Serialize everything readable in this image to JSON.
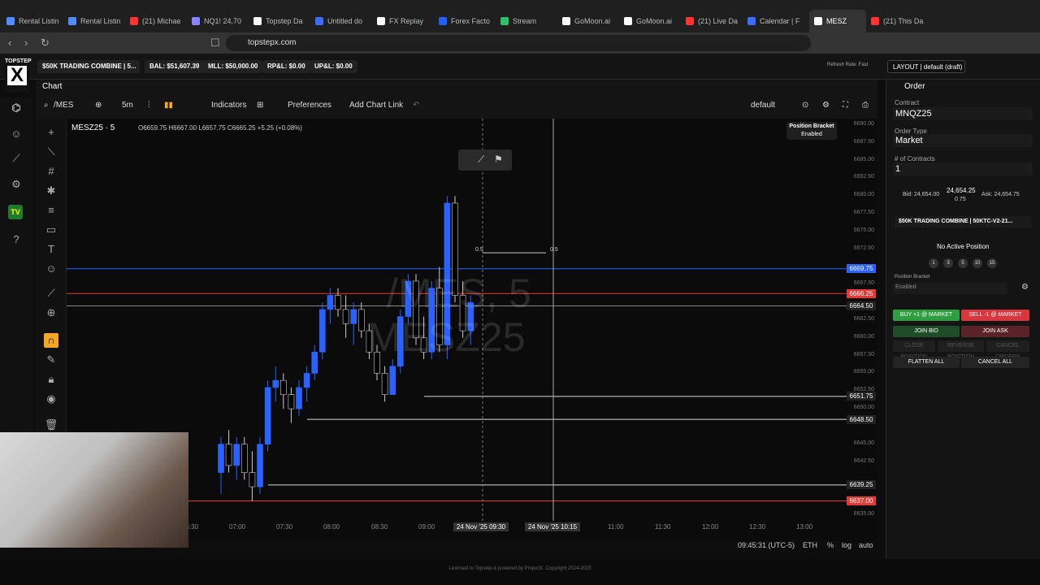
{
  "browser": {
    "tabs": [
      {
        "label": "Rental Listin",
        "color": "#4f8cff"
      },
      {
        "label": "Rental Listin",
        "color": "#4f8cff"
      },
      {
        "label": "(21) Michae",
        "color": "#ff3333"
      },
      {
        "label": "NQ1! 24,70",
        "color": "#8884ff"
      },
      {
        "label": "Topstep Da",
        "color": "#ffffff"
      },
      {
        "label": "Untitled do",
        "color": "#3d6bff"
      },
      {
        "label": "FX Replay",
        "color": "#ffffff"
      },
      {
        "label": "Forex Facto",
        "color": "#1f5fff"
      },
      {
        "label": "Stream",
        "color": "#29c36a"
      },
      {
        "label": "GoMoon.ai",
        "color": "#ffffff"
      },
      {
        "label": "GoMoon.ai",
        "color": "#ffffff"
      },
      {
        "label": "(21) Live Da",
        "color": "#ff3333"
      },
      {
        "label": "Calendar | F",
        "color": "#3d6bff"
      },
      {
        "label": "MESZ",
        "color": "#ffffff"
      },
      {
        "label": "(21) This Da",
        "color": "#ff3333"
      }
    ],
    "url": "topstepx.com"
  },
  "app": {
    "logo_top": "TOPSTEP",
    "logo_mark": "X",
    "account": "$50K TRADING COMBINE | 5...",
    "balance": "BAL: $51,607.39",
    "mll": "MLL: $50,000.00",
    "rpl": "RP&L: $0.00",
    "upl": "UP&L: $0.00",
    "refresh": "Refresh Rate: Fast",
    "layout": "LAYOUT | default (draft)"
  },
  "chart": {
    "tab": "Chart",
    "symbol_search": "/MES",
    "timeframe": "5m",
    "indicators": "Indicators",
    "preferences": "Preferences",
    "add_link": "Add Chart Link",
    "template": "default",
    "symbol_title": "MESZ25 · 5",
    "ohlc": "O6659.75 H6667.00 L6657.75 C6665.25 +5.25 (+0.08%)",
    "watermark_1": "/MES, 5",
    "watermark_2": "MESZ25",
    "position_bracket_title": "Position Bracket",
    "position_bracket_state": "Enabled",
    "ruler_left": "0.5",
    "ruler_right": "0.5",
    "price_labels": [
      {
        "price": "6669.75",
        "color": "#2962ff"
      },
      {
        "price": "6666.25",
        "color": "#e53935"
      },
      {
        "price": "6664.50",
        "color": "#222222"
      },
      {
        "price": "6651.75",
        "color": "#222222"
      },
      {
        "price": "6648.50",
        "color": "#222222"
      },
      {
        "price": "6639.25",
        "color": "#222222"
      },
      {
        "price": "6637.00",
        "color": "#e53935"
      }
    ],
    "axis_prices": [
      "6690.00",
      "6687.50",
      "6685.00",
      "6682.50",
      "6680.00",
      "6677.50",
      "6675.00",
      "6672.50",
      "6667.50",
      "6662.50",
      "6660.00",
      "6657.50",
      "6655.00",
      "6652.50",
      "6650.00",
      "6645.00",
      "6642.50",
      "6635.00"
    ],
    "axis_times": [
      "06:30",
      "07:00",
      "07:30",
      "08:00",
      "08:30",
      "09:00",
      "11:00",
      "11:30",
      "12:00",
      "12:30",
      "13:00"
    ],
    "cursor_time_1": "24 Nov '25   09:30",
    "cursor_time_2": "24 Nov '25   10:15",
    "clock": "09:45:31 (UTC-5)",
    "session": "ETH",
    "pct": "%",
    "log": "log",
    "auto": "auto"
  },
  "order": {
    "title": "Order",
    "contract_label": "Contract",
    "contract": "MNQZ25",
    "type_label": "Order Type",
    "type": "Market",
    "qty_label": "# of Contracts",
    "qty": "1",
    "bid": "Bid: 24,654.00",
    "last": "24,654.25",
    "spread": "0.75",
    "ask": "Ask: 24,654.75",
    "account": "$50K TRADING COMBINE | 50KTC-V2-21...",
    "no_position": "No Active Position",
    "qty_presets": [
      "1",
      "3",
      "5",
      "10",
      "15"
    ],
    "bracket_label": "Position Bracket",
    "bracket": "Enabled",
    "buy": "BUY +1 @ MARKET",
    "sell": "SELL -1 @ MARKET",
    "join_bid": "JOIN BID",
    "join_ask": "JOIN ASK",
    "close_position": "CLOSE POSITION",
    "reverse_position": "REVERSE POSITION",
    "cancel_orders": "CANCEL ORDERS",
    "flatten_all": "FLATTEN ALL",
    "cancel_all": "CANCEL ALL"
  },
  "footer": "Licensed to Topstep & powered by ProjectX. Copyright 2024-2025",
  "candles": [
    {
      "t": "07:00",
      "o": 6641,
      "h": 6646,
      "l": 6638,
      "c": 6645
    },
    {
      "t": "07:05",
      "o": 6645,
      "h": 6647,
      "l": 6641,
      "c": 6642
    },
    {
      "t": "07:10",
      "o": 6642,
      "h": 6646,
      "l": 6640,
      "c": 6645
    },
    {
      "t": "07:15",
      "o": 6645,
      "h": 6646,
      "l": 6640,
      "c": 6641
    },
    {
      "t": "07:20",
      "o": 6641,
      "h": 6644,
      "l": 6637,
      "c": 6639
    },
    {
      "t": "07:25",
      "o": 6639,
      "h": 6646,
      "l": 6638,
      "c": 6645
    },
    {
      "t": "07:30",
      "o": 6645,
      "h": 6654,
      "l": 6644,
      "c": 6653
    },
    {
      "t": "07:35",
      "o": 6653,
      "h": 6656,
      "l": 6651,
      "c": 6654
    },
    {
      "t": "07:40",
      "o": 6654,
      "h": 6655,
      "l": 6650,
      "c": 6652
    },
    {
      "t": "07:45",
      "o": 6652,
      "h": 6653,
      "l": 6648,
      "c": 6650
    },
    {
      "t": "07:50",
      "o": 6650,
      "h": 6654,
      "l": 6649,
      "c": 6653
    },
    {
      "t": "07:55",
      "o": 6653,
      "h": 6656,
      "l": 6651,
      "c": 6655
    },
    {
      "t": "08:00",
      "o": 6655,
      "h": 6659,
      "l": 6654,
      "c": 6658
    },
    {
      "t": "08:05",
      "o": 6658,
      "h": 6665,
      "l": 6657,
      "c": 6664
    },
    {
      "t": "08:10",
      "o": 6664,
      "h": 6667,
      "l": 6662,
      "c": 6666
    },
    {
      "t": "08:15",
      "o": 6666,
      "h": 6667,
      "l": 6663,
      "c": 6664
    },
    {
      "t": "08:20",
      "o": 6664,
      "h": 6666,
      "l": 6660,
      "c": 6662
    },
    {
      "t": "08:25",
      "o": 6662,
      "h": 6665,
      "l": 6659,
      "c": 6664
    },
    {
      "t": "08:30",
      "o": 6664,
      "h": 6665,
      "l": 6660,
      "c": 6661
    },
    {
      "t": "08:35",
      "o": 6661,
      "h": 6662,
      "l": 6657,
      "c": 6658
    },
    {
      "t": "08:40",
      "o": 6658,
      "h": 6659,
      "l": 6654,
      "c": 6655
    },
    {
      "t": "08:45",
      "o": 6655,
      "h": 6656,
      "l": 6651,
      "c": 6652
    },
    {
      "t": "08:50",
      "o": 6652,
      "h": 6657,
      "l": 6652,
      "c": 6656
    },
    {
      "t": "08:55",
      "o": 6656,
      "h": 6664,
      "l": 6655,
      "c": 6663
    },
    {
      "t": "09:00",
      "o": 6663,
      "h": 6669,
      "l": 6662,
      "c": 6668
    },
    {
      "t": "09:05",
      "o": 6668,
      "h": 6669,
      "l": 6659,
      "c": 6660
    },
    {
      "t": "09:10",
      "o": 6660,
      "h": 6663,
      "l": 6657,
      "c": 6658
    },
    {
      "t": "09:15",
      "o": 6658,
      "h": 6668,
      "l": 6657,
      "c": 6667
    },
    {
      "t": "09:20",
      "o": 6667,
      "h": 6670,
      "l": 6658,
      "c": 6659
    },
    {
      "t": "09:25",
      "o": 6659,
      "h": 6680,
      "l": 6657,
      "c": 6679
    },
    {
      "t": "09:30",
      "o": 6679,
      "h": 6680,
      "l": 6665,
      "c": 6666
    },
    {
      "t": "09:35",
      "o": 6666,
      "h": 6668,
      "l": 6660,
      "c": 6661
    },
    {
      "t": "09:40",
      "o": 6661,
      "h": 6666,
      "l": 6659,
      "c": 6665
    }
  ]
}
